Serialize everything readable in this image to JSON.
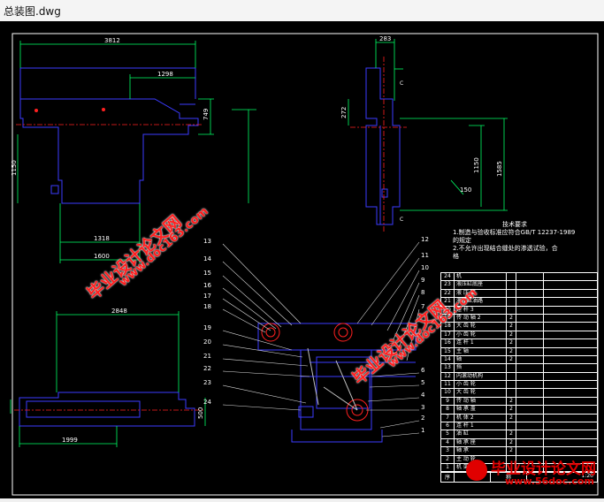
{
  "window": {
    "title": "总装图.dwg"
  },
  "dims": {
    "top_width": "3812",
    "top_inner": "1298",
    "top_height_right": "749",
    "left_height": "1150",
    "bottom_a": "1318",
    "bottom_b": "1600",
    "side_width": "283",
    "side_272": "272",
    "side_1150": "1150",
    "side_150": "150",
    "side_1585": "1585",
    "plan_width": "2848",
    "plan_bottom": "1999",
    "plan_side": "500"
  },
  "section_marks": {
    "c1": "C",
    "c2": "C"
  },
  "callouts_left": [
    "13",
    "14",
    "15",
    "16",
    "17",
    "18",
    "19",
    "20",
    "21",
    "22",
    "23",
    "24"
  ],
  "callouts_right": [
    "12",
    "11",
    "10",
    "9",
    "8",
    "7",
    "6",
    "5",
    "4",
    "3",
    "2",
    "1"
  ],
  "tech_notes": {
    "heading": "技术要求",
    "line1": "1.制造与验收标准应符合GB/T 12237-1989",
    "line1b": "的规定",
    "line2": "2.不允许出现结合缝处的渗透试验，合",
    "line2b": "格"
  },
  "bom_rows": [
    {
      "no": "24",
      "name": "机",
      "mark": ""
    },
    {
      "no": "23",
      "name": "液压缸底座",
      "mark": ""
    },
    {
      "no": "22",
      "name": "液 压 缸",
      "mark": ""
    },
    {
      "no": "21",
      "name": "液压缸油路",
      "mark": ""
    },
    {
      "no": "20",
      "name": "连 杆 3",
      "mark": ""
    },
    {
      "no": "19",
      "name": "传 动 轴 2",
      "mark": "2"
    },
    {
      "no": "18",
      "name": "大 齿 轮",
      "mark": "2"
    },
    {
      "no": "17",
      "name": "小 齿 轮",
      "mark": "2"
    },
    {
      "no": "16",
      "name": "连 杆 1",
      "mark": "2"
    },
    {
      "no": "15",
      "name": "主 轴",
      "mark": "2"
    },
    {
      "no": "14",
      "name": "轴",
      "mark": "2"
    },
    {
      "no": "13",
      "name": "挡",
      "mark": ""
    },
    {
      "no": "12",
      "name": "内滚动机构",
      "mark": ""
    },
    {
      "no": "11",
      "name": "小 齿 轮",
      "mark": ""
    },
    {
      "no": "10",
      "name": "大 齿 轮",
      "mark": ""
    },
    {
      "no": "9",
      "name": "传 动 轴",
      "mark": "2"
    },
    {
      "no": "8",
      "name": "轴 承 盖",
      "mark": "2"
    },
    {
      "no": "7",
      "name": "机 体 2",
      "mark": "2"
    },
    {
      "no": "6",
      "name": "连 杆 1",
      "mark": ""
    },
    {
      "no": "5",
      "name": "油 缸",
      "mark": "2"
    },
    {
      "no": "4",
      "name": "轴 承 座",
      "mark": "2"
    },
    {
      "no": "3",
      "name": "轴 承",
      "mark": "2"
    },
    {
      "no": "2",
      "name": "主 动 轮",
      "mark": ""
    },
    {
      "no": "1",
      "name": "机 架",
      "mark": ""
    }
  ],
  "bom_footer": {
    "col1": "序",
    "col2": "名",
    "col3": "称",
    "scale": "1:20"
  },
  "watermark": {
    "brand": "毕业设计论文网",
    "url": "www.56doc.com",
    "side_url": "www.doc163.com"
  },
  "colors": {
    "background": "#000000",
    "outline": "#3b3bff",
    "dimension": "#00ff66",
    "text": "#ffffff",
    "centerline": "#ff2020",
    "callout": "#ffffff",
    "watermark": "#ff2020"
  }
}
